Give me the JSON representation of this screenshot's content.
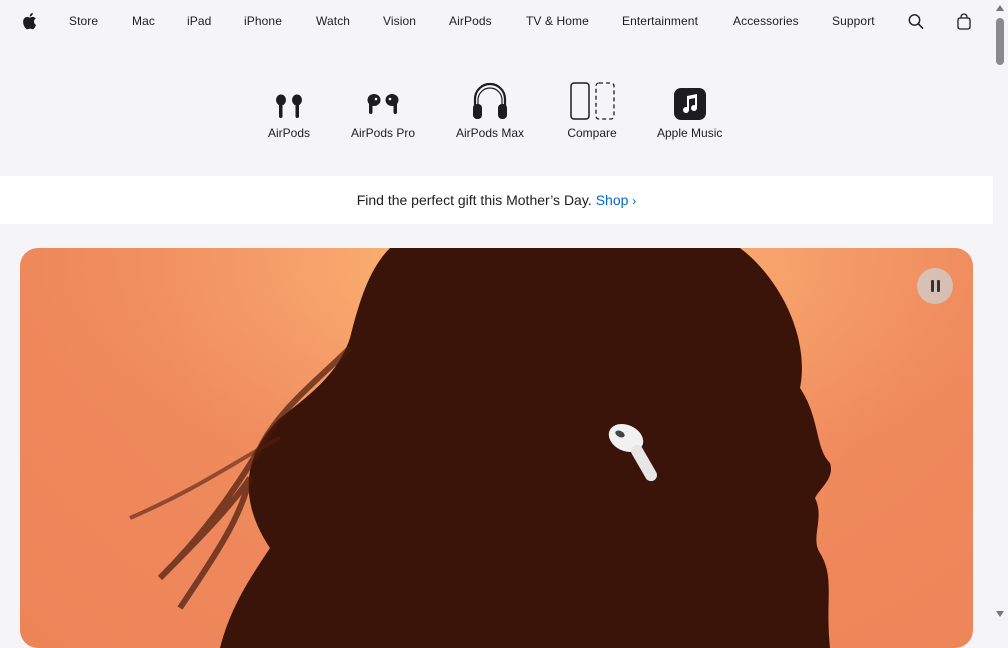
{
  "globalnav": {
    "items": [
      "Store",
      "Mac",
      "iPad",
      "iPhone",
      "Watch",
      "Vision",
      "AirPods",
      "TV & Home",
      "Entertainment",
      "Accessories",
      "Support"
    ],
    "icons": [
      "apple-logo",
      "search-icon",
      "bag-icon"
    ]
  },
  "chapternav": {
    "items": [
      {
        "label": "AirPods",
        "icon": "airpods-icon"
      },
      {
        "label": "AirPods Pro",
        "icon": "airpods-pro-icon"
      },
      {
        "label": "AirPods Max",
        "icon": "headphones-icon"
      },
      {
        "label": "Compare",
        "icon": "compare-icon"
      },
      {
        "label": "Apple Music",
        "icon": "music-icon"
      }
    ]
  },
  "ribbon": {
    "text": "Find the perfect gift this Mother’s Day.",
    "link": "Shop"
  },
  "hero": {
    "controls": {
      "pause_icon": "pause-icon"
    }
  },
  "colors": {
    "link": "#0066cc",
    "background": "#f5f5f7",
    "hero_orange": "#ef8a5d"
  }
}
